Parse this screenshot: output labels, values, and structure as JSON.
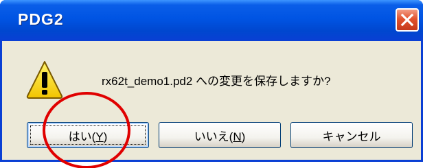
{
  "window": {
    "title": "PDG2",
    "accent_color": "#0054e3",
    "close_icon": "close-x-icon"
  },
  "dialog": {
    "icon": "warning-icon",
    "message": "rx62t_demo1.pd2 への変更を保存しますか?"
  },
  "buttons": {
    "yes": {
      "label_pre": "はい(",
      "mnemonic": "Y",
      "label_post": ")"
    },
    "no": {
      "label_pre": "いいえ(",
      "mnemonic": "N",
      "label_post": ")"
    },
    "cancel": {
      "label": "キャンセル"
    }
  },
  "annotation": {
    "shape": "circle",
    "color": "#e00000"
  }
}
